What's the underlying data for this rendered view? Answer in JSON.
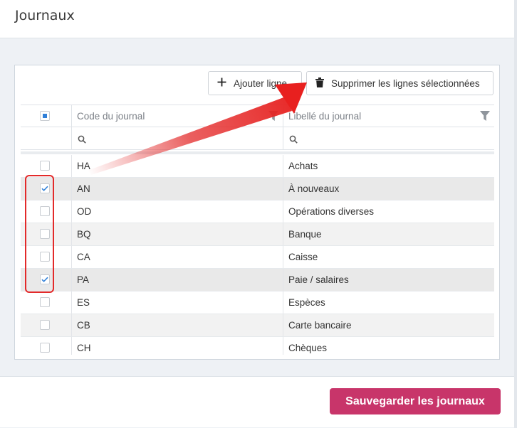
{
  "page": {
    "title": "Journaux"
  },
  "toolbar": {
    "add_label": "Ajouter ligne",
    "delete_label": "Supprimer les lignes sélectionnées"
  },
  "table": {
    "columns": [
      "Code du journal",
      "Libellé du journal"
    ],
    "rows": [
      {
        "code": "HA",
        "label": "Achats",
        "checked": false
      },
      {
        "code": "AN",
        "label": "À nouveaux",
        "checked": true
      },
      {
        "code": "OD",
        "label": "Opérations diverses",
        "checked": false
      },
      {
        "code": "BQ",
        "label": "Banque",
        "checked": false
      },
      {
        "code": "CA",
        "label": "Caisse",
        "checked": false
      },
      {
        "code": "PA",
        "label": "Paie / salaires",
        "checked": true
      },
      {
        "code": "ES",
        "label": "Espèces",
        "checked": false
      },
      {
        "code": "CB",
        "label": "Carte bancaire",
        "checked": false
      },
      {
        "code": "CH",
        "label": "Chèques",
        "checked": false
      }
    ]
  },
  "footer": {
    "save_label": "Sauvegarder les journaux"
  },
  "colors": {
    "accent": "#c8356a",
    "annotation": "#e32a2a",
    "checkbox": "#2f7fd8"
  }
}
